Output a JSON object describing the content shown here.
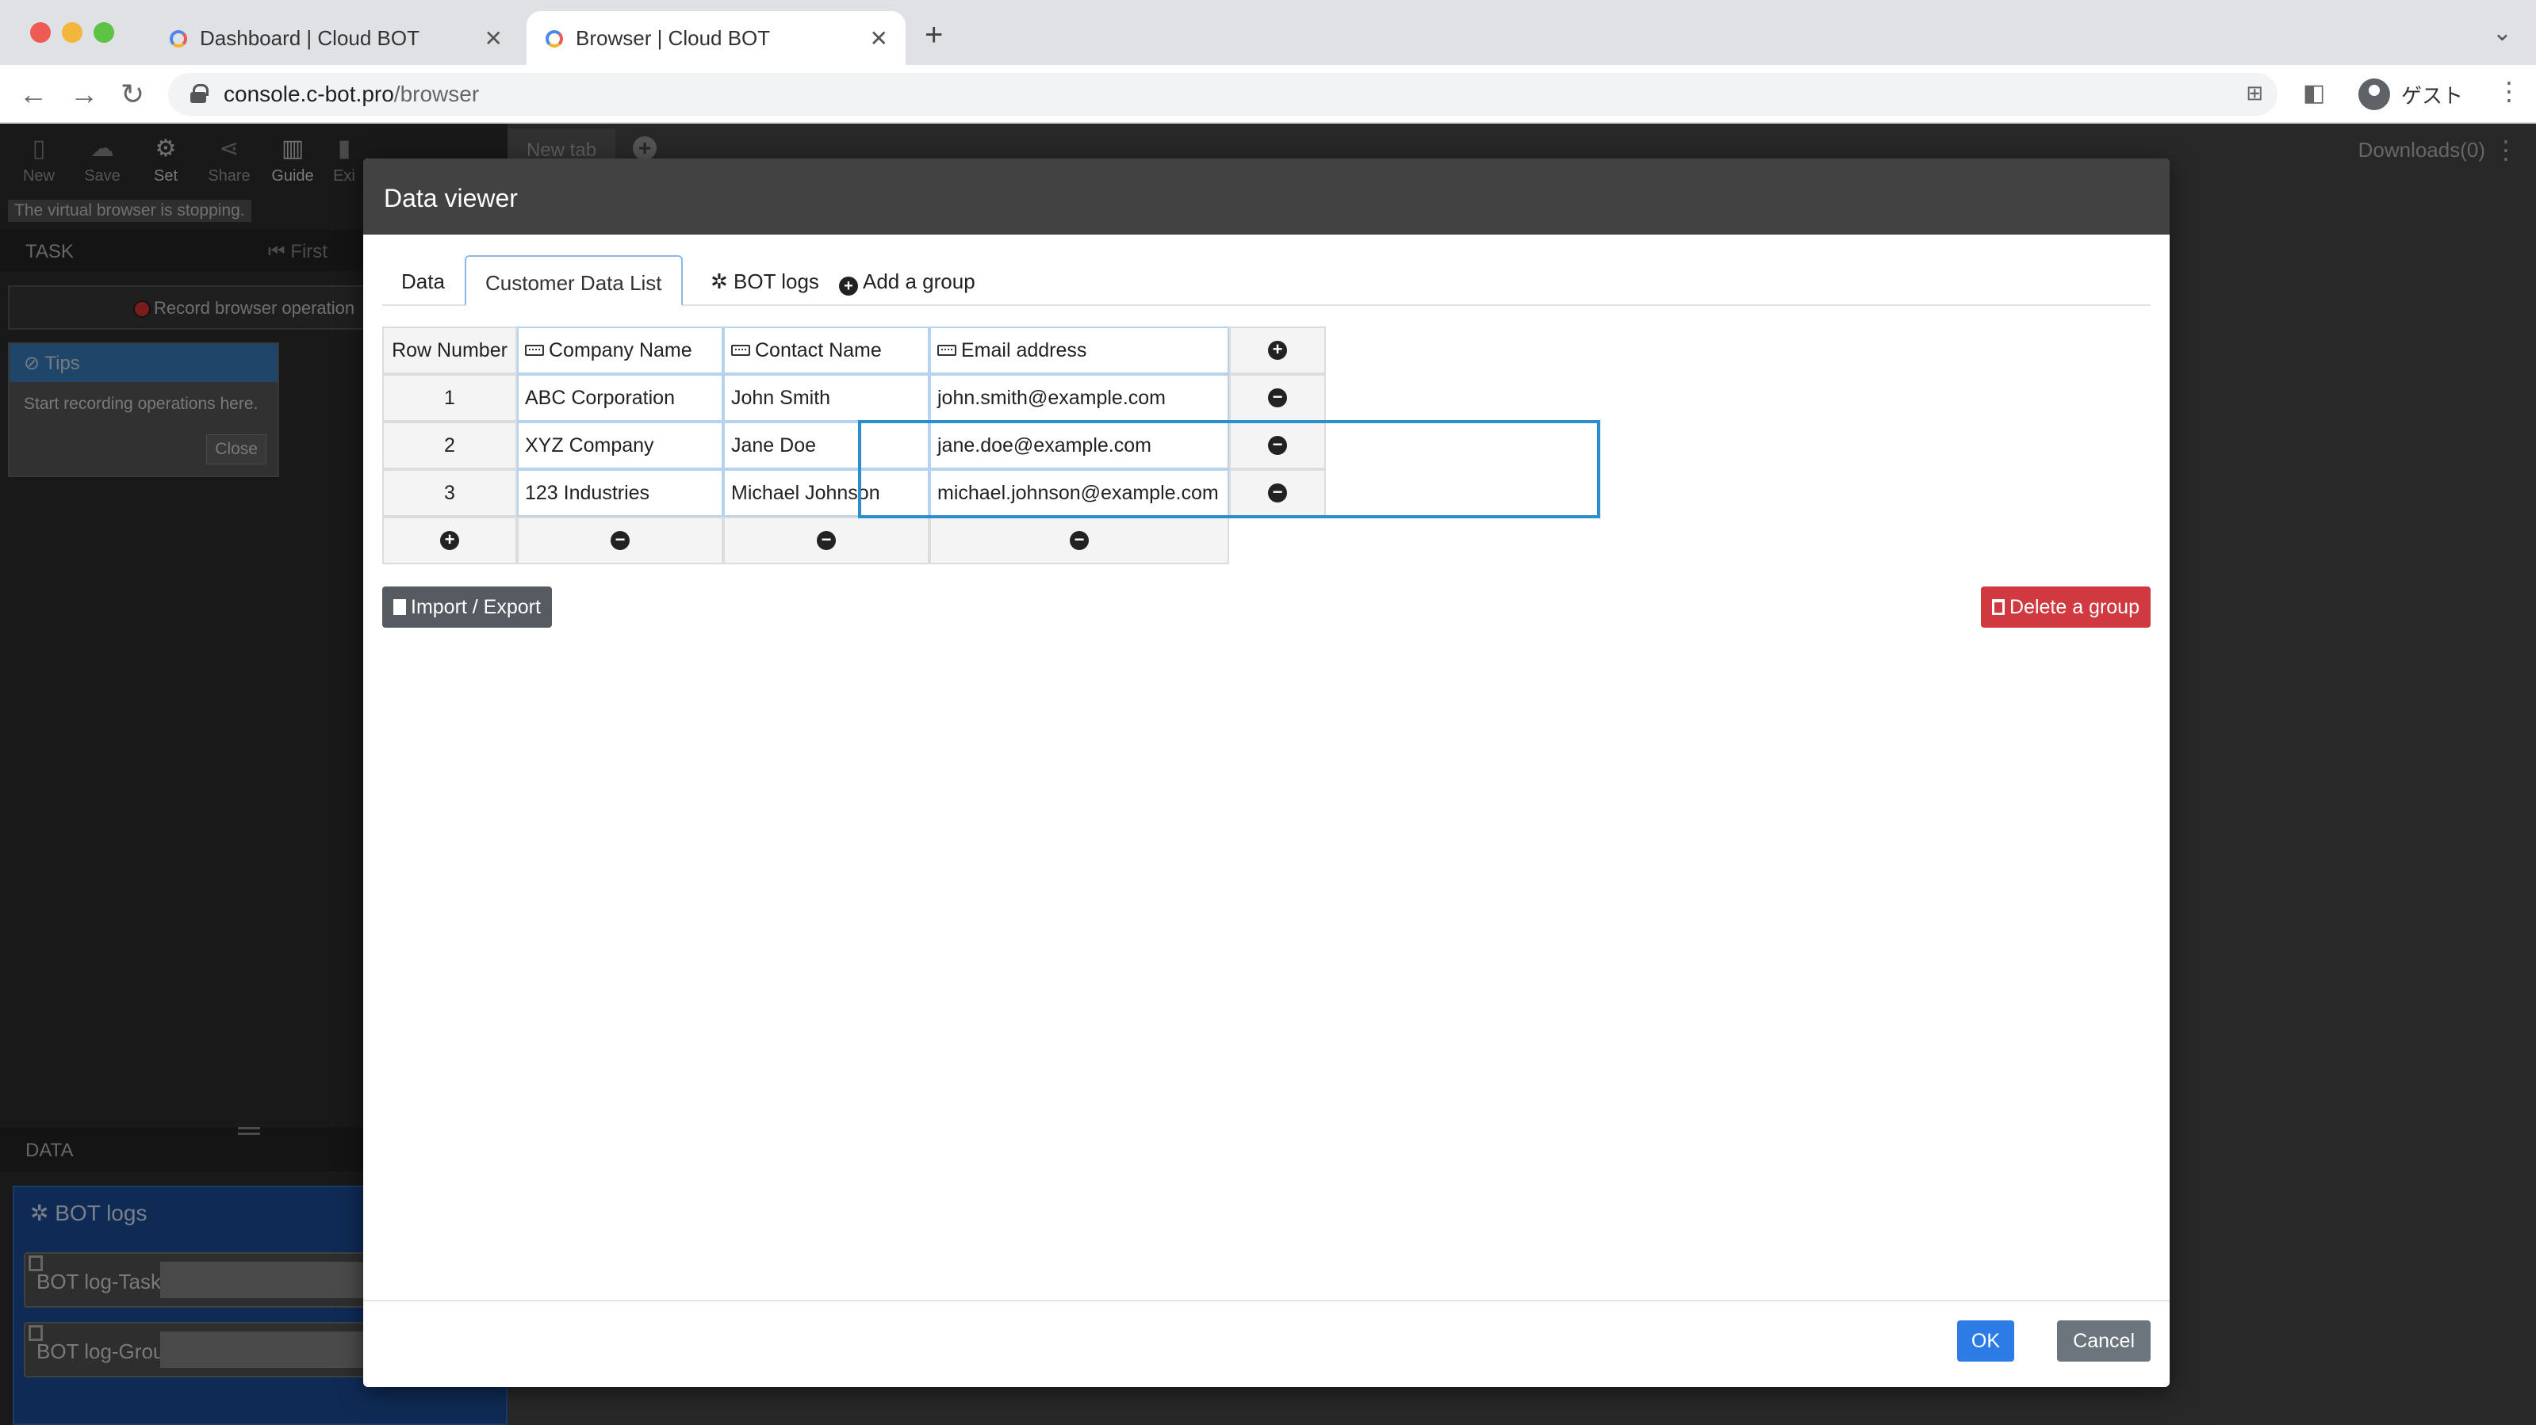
{
  "browser": {
    "tabs": [
      {
        "title": "Dashboard | Cloud BOT",
        "active": false
      },
      {
        "title": "Browser | Cloud BOT",
        "active": true
      }
    ],
    "url_host": "console.c-bot.pro",
    "url_path": "/browser",
    "profile_label": "ゲスト"
  },
  "toolbar": {
    "new": "New",
    "save": "Save",
    "set": "Set",
    "share": "Share",
    "guide": "Guide",
    "exit": "Exi"
  },
  "status_text": "The virtual browser is stopping.",
  "task_panel": {
    "header": "TASK",
    "first_label": "First",
    "record_label": "Record browser operation"
  },
  "tips": {
    "title": "Tips",
    "body": "Start recording operations here.",
    "close": "Close"
  },
  "data_panel": {
    "header": "DATA",
    "bot_logs": "BOT logs",
    "items": [
      "BOT log-Task",
      "BOT log-Grou"
    ]
  },
  "virtual_browser": {
    "tab_label": "New tab",
    "downloads": "Downloads(0)"
  },
  "modal": {
    "title": "Data viewer",
    "tabs": {
      "data": "Data",
      "customer": "Customer Data List",
      "bot_logs": "BOT logs",
      "add_group": "Add a group"
    },
    "table": {
      "row_number_header": "Row Number",
      "columns": [
        "Company Name",
        "Contact Name",
        "Email address"
      ],
      "rows": [
        {
          "n": "1",
          "company": "ABC Corporation",
          "contact": "John Smith",
          "email": "john.smith@example.com"
        },
        {
          "n": "2",
          "company": "XYZ Company",
          "contact": "Jane Doe",
          "email": "jane.doe@example.com"
        },
        {
          "n": "3",
          "company": "123 Industries",
          "contact": "Michael Johnson",
          "email": "michael.johnson@example.com"
        }
      ]
    },
    "import_export": "Import / Export",
    "delete_group": "Delete a group",
    "ok": "OK",
    "cancel": "Cancel"
  }
}
